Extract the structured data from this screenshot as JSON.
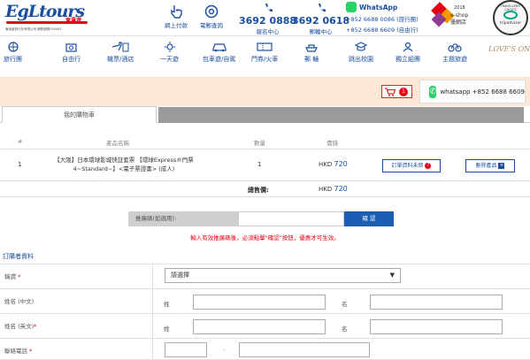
{
  "header": {
    "logo_text": "EgLtours",
    "logo_cn": "東瀛遊",
    "logo_sub": "東瀛遊旅行社有限公司 牌照號碼350562",
    "pay_label": "網上付款",
    "email_label": "電郵查詢",
    "phone1": {
      "number": "3692 0888",
      "label": "報名中心"
    },
    "phone2": {
      "number": "3692 0618",
      "label": "郵輪中心"
    },
    "whatsapp_title": "WhatsApp",
    "whatsapp_line1": "+852 6688 0086 (旅行團)",
    "whatsapp_line2": "+852 6688 6609 (自由行)",
    "award_year": "2018",
    "award_label": "e-shop 優網店",
    "trip_label": "tripadvisor",
    "trip_top": "TRAVELLERS' CHOICE"
  },
  "nav": {
    "items": [
      "旅行團",
      "自由行",
      "機票/酒店",
      "一天遊",
      "包車遊/自駕",
      "門券/火車",
      "郵 輪",
      "跳出校園",
      "獨立組團",
      "主題旅遊"
    ],
    "loves_label": "LOVE'S ON"
  },
  "cart": {
    "count": "1",
    "whatsapp_text": "whatsapp +852 6688 6609"
  },
  "tabs": {
    "active": "我的購物車",
    "inactive": ""
  },
  "table": {
    "headers": {
      "num": "#",
      "name": "產品名稱",
      "qty": "數量",
      "price": "價錢"
    },
    "row": {
      "num": "1",
      "name": "【大阪】日本環球影城快証套票 【環球Express®門票 4~Standard~】<電子票證書> (成人)",
      "qty": "1",
      "currency": "HKD",
      "amount": "720",
      "detail_button": "訂單資料未齊",
      "delete_button": "刪除產品"
    },
    "total_label": "總售價:",
    "total_currency": "HKD",
    "total_amount": "720"
  },
  "coupon": {
    "label": "推廣碼(如適用):",
    "placeholder": "",
    "button": "確 認",
    "hint": "輸入有效推廣碼後，必須點擊\"確認\"按鈕，優惠才可生效。"
  },
  "form": {
    "section_title": "訂購者資料",
    "title_label": "稱謂",
    "title_select": "請選擇",
    "name_cn_label": "姓名 (中文)",
    "name_en_label": "姓名 (英文)",
    "surname_label": "姓",
    "given_label": "名",
    "phone_label": "聯絡電話",
    "dash": "-"
  },
  "colors": {
    "brand_blue": "#1a4fa0",
    "accent_red": "#e60012",
    "whatsapp_green": "#25d366",
    "cart_bar": "#fde8d6"
  }
}
